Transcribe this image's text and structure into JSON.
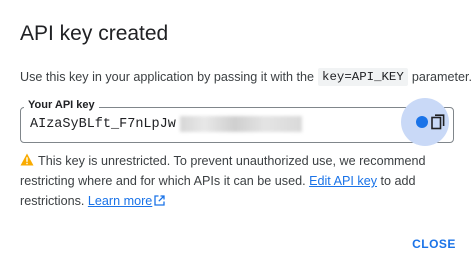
{
  "dialog": {
    "title": "API key created",
    "description_before": "Use this key in your application by passing it with the",
    "code_param": "key=API_KEY",
    "description_after": "parameter.",
    "field_label": "Your API key",
    "api_key_visible": "AIzaSyBLft_F7nLpJw",
    "warning_text_1": "This key is unrestricted. To prevent unauthorized use, we recommend restricting where and for which APIs it can be used.",
    "edit_link": "Edit API key",
    "warning_text_2": "to add restrictions.",
    "learn_more": "Learn more",
    "close_label": "CLOSE"
  },
  "icons": {
    "copy": "content-copy-icon",
    "warning": "warning-triangle-icon",
    "external": "open-in-new-icon"
  },
  "colors": {
    "accent": "#1a73e8",
    "warning": "#f9ab00",
    "copy_highlight": "#c9d9f7"
  }
}
